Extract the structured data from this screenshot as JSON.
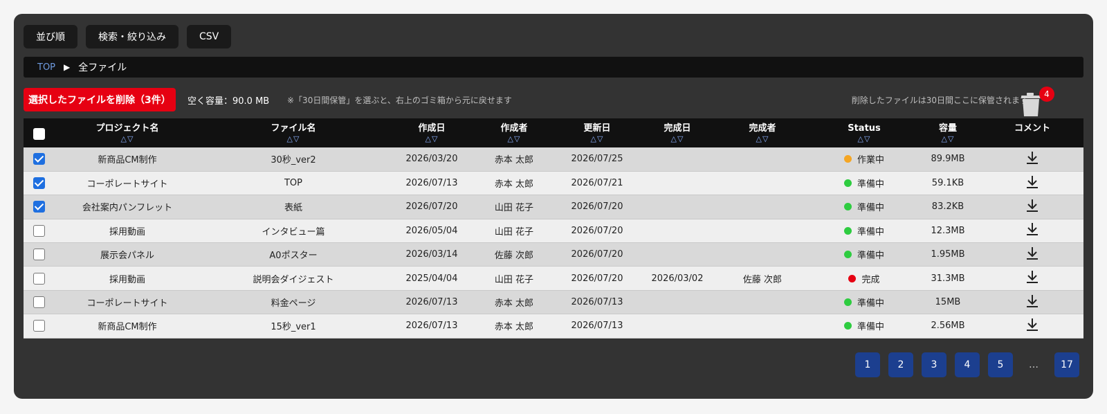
{
  "toolbar": {
    "sort_label": "並び順",
    "search_label": "検索・絞り込み",
    "csv_label": "CSV"
  },
  "breadcrumb": {
    "top": "TOP",
    "current": "全ファイル"
  },
  "actions": {
    "delete_label": "選択したファイルを削除（3件）",
    "capacity": "空く容量：90.0 MB",
    "note": "※「30日間保管」を選ぶと、右上のゴミ箱から元に戻せます",
    "trash_note": "削除したファイルは30日間ここに保管されます",
    "trash_count": "4"
  },
  "sort_glyph": "△▽",
  "columns": [
    "プロジェクト名",
    "ファイル名",
    "作成日",
    "作成者",
    "更新日",
    "完成日",
    "完成者",
    "Status",
    "容量",
    "コメント"
  ],
  "status_colors": {
    "作業中": "#f5a623",
    "準備中": "#2ecc40",
    "完成": "#e60012"
  },
  "rows": [
    {
      "checked": true,
      "project": "新商品CM制作",
      "file": "30秒_ver2",
      "created": "2026/03/20",
      "creator": "赤本 太郎",
      "updated": "2026/07/25",
      "completed": "",
      "completer": "",
      "status": "作業中",
      "size": "89.9MB"
    },
    {
      "checked": true,
      "project": "コーポレートサイト",
      "file": "TOP",
      "created": "2026/07/13",
      "creator": "赤本 太郎",
      "updated": "2026/07/21",
      "completed": "",
      "completer": "",
      "status": "準備中",
      "size": "59.1KB"
    },
    {
      "checked": true,
      "project": "会社案内パンフレット",
      "file": "表紙",
      "created": "2026/07/20",
      "creator": "山田 花子",
      "updated": "2026/07/20",
      "completed": "",
      "completer": "",
      "status": "準備中",
      "size": "83.2KB"
    },
    {
      "checked": false,
      "project": "採用動画",
      "file": "インタビュー篇",
      "created": "2026/05/04",
      "creator": "山田 花子",
      "updated": "2026/07/20",
      "completed": "",
      "completer": "",
      "status": "準備中",
      "size": "12.3MB"
    },
    {
      "checked": false,
      "project": "展示会パネル",
      "file": "A0ポスター",
      "created": "2026/03/14",
      "creator": "佐藤 次郎",
      "updated": "2026/07/20",
      "completed": "",
      "completer": "",
      "status": "準備中",
      "size": "1.95MB"
    },
    {
      "checked": false,
      "project": "採用動画",
      "file": "説明会ダイジェスト",
      "created": "2025/04/04",
      "creator": "山田 花子",
      "updated": "2026/07/20",
      "completed": "2026/03/02",
      "completer": "佐藤 次郎",
      "status": "完成",
      "size": "31.3MB"
    },
    {
      "checked": false,
      "project": "コーポレートサイト",
      "file": "料金ページ",
      "created": "2026/07/13",
      "creator": "赤本 太郎",
      "updated": "2026/07/13",
      "completed": "",
      "completer": "",
      "status": "準備中",
      "size": "15MB"
    },
    {
      "checked": false,
      "project": "新商品CM制作",
      "file": "15秒_ver1",
      "created": "2026/07/13",
      "creator": "赤本 太郎",
      "updated": "2026/07/13",
      "completed": "",
      "completer": "",
      "status": "準備中",
      "size": "2.56MB"
    }
  ],
  "pagination": {
    "pages": [
      "1",
      "2",
      "3",
      "4",
      "5"
    ],
    "ellipsis": "…",
    "last": "17"
  }
}
